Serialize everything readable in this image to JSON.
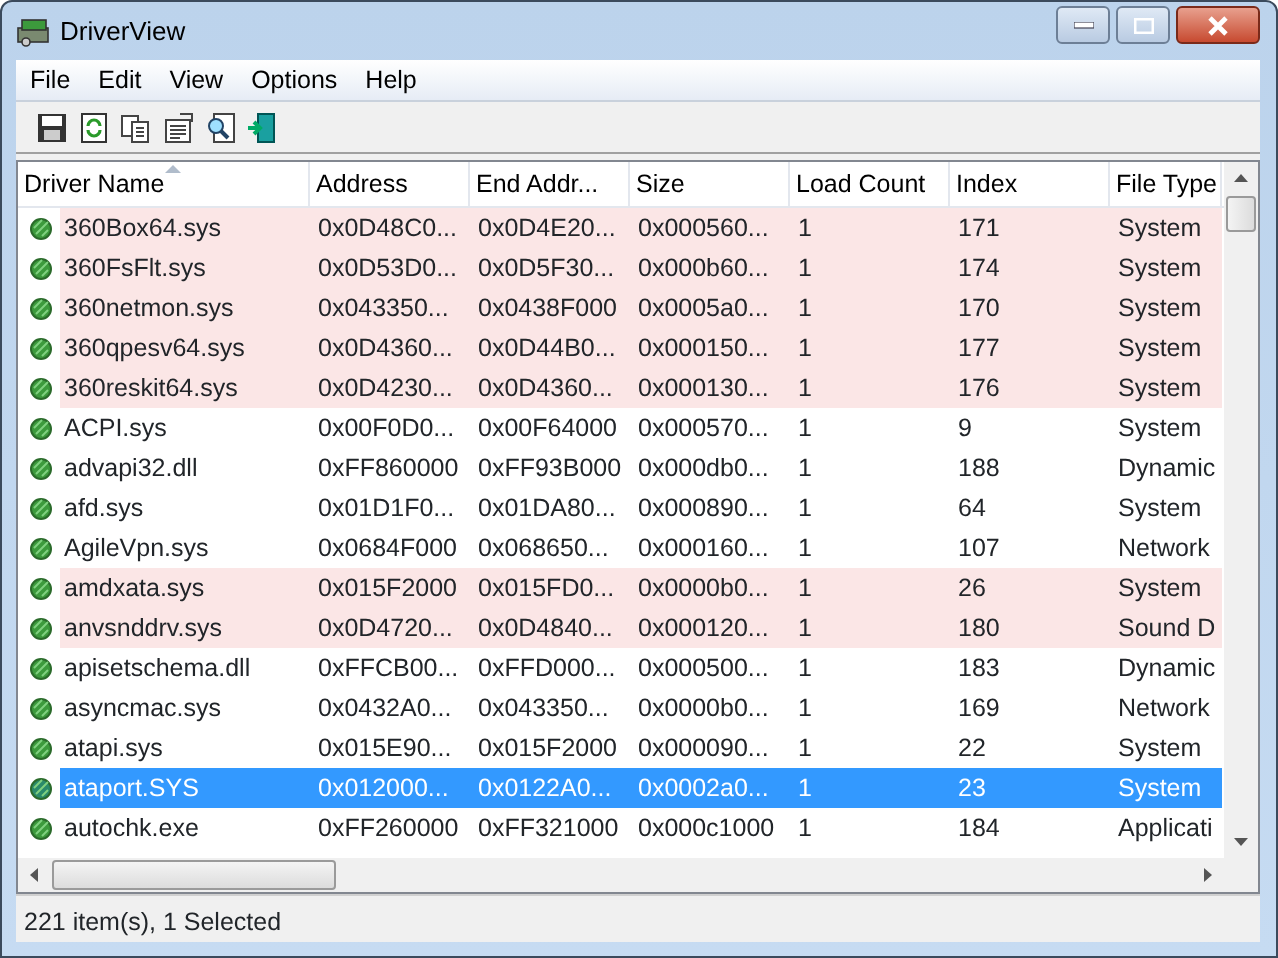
{
  "window": {
    "title": "DriverView"
  },
  "menu": [
    "File",
    "Edit",
    "View",
    "Options",
    "Help"
  ],
  "toolbar": [
    {
      "kind": "save"
    },
    {
      "kind": "refresh"
    },
    {
      "kind": "copy"
    },
    {
      "kind": "properties"
    },
    {
      "kind": "find"
    },
    {
      "kind": "exit"
    }
  ],
  "table": {
    "columns": [
      {
        "label": "Driver Name",
        "sorted": true
      },
      {
        "label": "Address",
        "sorted": false
      },
      {
        "label": "End Addr...",
        "sorted": false
      },
      {
        "label": "Size",
        "sorted": false
      },
      {
        "label": "Load Count",
        "sorted": false
      },
      {
        "label": "Index",
        "sorted": false
      },
      {
        "label": "File Type",
        "sorted": false
      }
    ],
    "rows": [
      {
        "cells": [
          "360Box64.sys",
          "0x0D48C0...",
          "0x0D4E20...",
          "0x000560...",
          "1",
          "171",
          "System"
        ],
        "highlighted": true,
        "selected": false
      },
      {
        "cells": [
          "360FsFlt.sys",
          "0x0D53D0...",
          "0x0D5F30...",
          "0x000b60...",
          "1",
          "174",
          "System"
        ],
        "highlighted": true,
        "selected": false
      },
      {
        "cells": [
          "360netmon.sys",
          "0x043350...",
          "0x0438F000",
          "0x0005a0...",
          "1",
          "170",
          "System"
        ],
        "highlighted": true,
        "selected": false
      },
      {
        "cells": [
          "360qpesv64.sys",
          "0x0D4360...",
          "0x0D44B0...",
          "0x000150...",
          "1",
          "177",
          "System"
        ],
        "highlighted": true,
        "selected": false
      },
      {
        "cells": [
          "360reskit64.sys",
          "0x0D4230...",
          "0x0D4360...",
          "0x000130...",
          "1",
          "176",
          "System"
        ],
        "highlighted": true,
        "selected": false
      },
      {
        "cells": [
          "ACPI.sys",
          "0x00F0D0...",
          "0x00F64000",
          "0x000570...",
          "1",
          "9",
          "System"
        ],
        "highlighted": false,
        "selected": false
      },
      {
        "cells": [
          "advapi32.dll",
          "0xFF860000",
          "0xFF93B000",
          "0x000db0...",
          "1",
          "188",
          "Dynamic"
        ],
        "highlighted": false,
        "selected": false
      },
      {
        "cells": [
          "afd.sys",
          "0x01D1F0...",
          "0x01DA80...",
          "0x000890...",
          "1",
          "64",
          "System"
        ],
        "highlighted": false,
        "selected": false
      },
      {
        "cells": [
          "AgileVpn.sys",
          "0x0684F000",
          "0x068650...",
          "0x000160...",
          "1",
          "107",
          "Network"
        ],
        "highlighted": false,
        "selected": false
      },
      {
        "cells": [
          "amdxata.sys",
          "0x015F2000",
          "0x015FD0...",
          "0x0000b0...",
          "1",
          "26",
          "System"
        ],
        "highlighted": true,
        "selected": false
      },
      {
        "cells": [
          "anvsnddrv.sys",
          "0x0D4720...",
          "0x0D4840...",
          "0x000120...",
          "1",
          "180",
          "Sound D"
        ],
        "highlighted": true,
        "selected": false
      },
      {
        "cells": [
          "apisetschema.dll",
          "0xFFCB00...",
          "0xFFD000...",
          "0x000500...",
          "1",
          "183",
          "Dynamic"
        ],
        "highlighted": false,
        "selected": false
      },
      {
        "cells": [
          "asyncmac.sys",
          "0x0432A0...",
          "0x043350...",
          "0x0000b0...",
          "1",
          "169",
          "Network"
        ],
        "highlighted": false,
        "selected": false
      },
      {
        "cells": [
          "atapi.sys",
          "0x015E90...",
          "0x015F2000",
          "0x000090...",
          "1",
          "22",
          "System"
        ],
        "highlighted": false,
        "selected": false
      },
      {
        "cells": [
          "ataport.SYS",
          "0x012000...",
          "0x0122A0...",
          "0x0002a0...",
          "1",
          "23",
          "System"
        ],
        "selected": true
      },
      {
        "cells": [
          "autochk.exe",
          "0xFF260000",
          "0xFF321000",
          "0x000c1000",
          "1",
          "184",
          "Applicati"
        ],
        "highlighted": false,
        "selected": false
      }
    ]
  },
  "status_bar": "221 item(s), 1 Selected"
}
